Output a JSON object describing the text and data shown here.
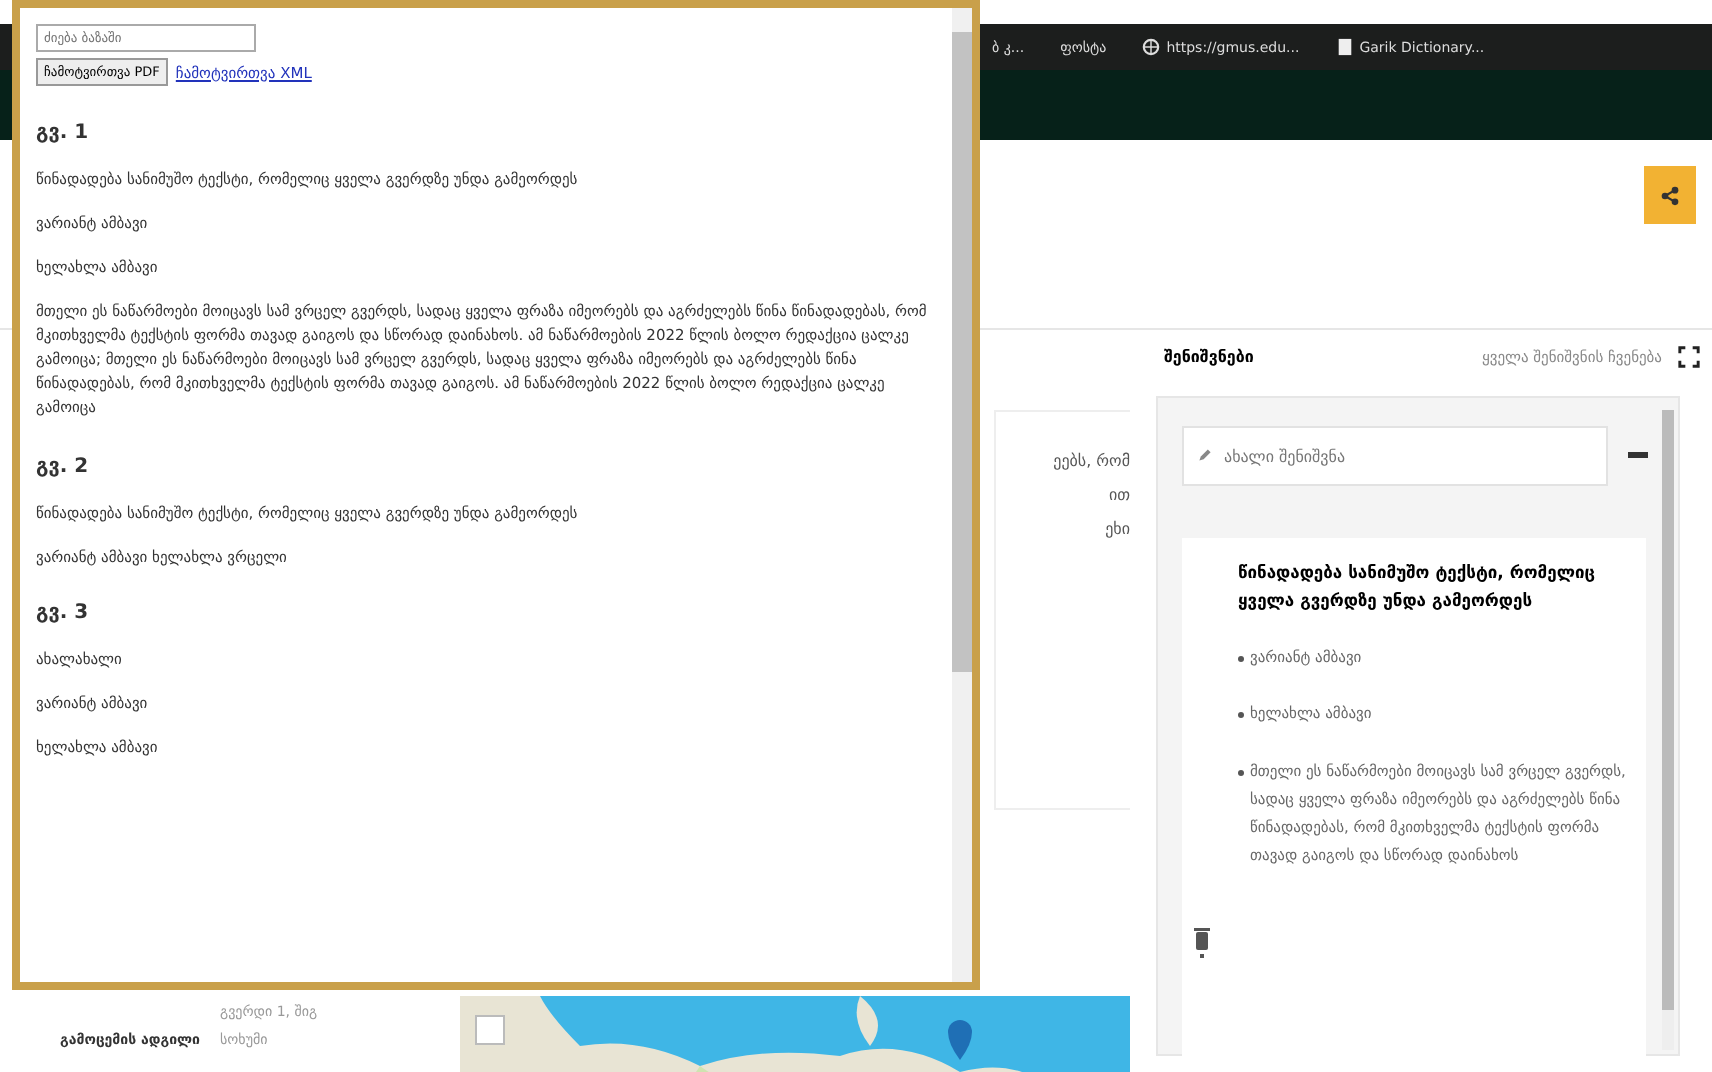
{
  "browser": {
    "bookmarks": [
      {
        "label": "ბ კ..."
      },
      {
        "label": "ფოსტა"
      },
      {
        "label": "https://gmus.edu...",
        "kind": "globe"
      },
      {
        "label": "Garik Dictionary...",
        "kind": "page"
      }
    ]
  },
  "background_page": {
    "card_fragments": [
      "ეებს, რომ",
      "ით",
      "ეხი"
    ],
    "details": [
      {
        "value": "გვერდი 1, შიგ"
      },
      {
        "label": "გამოცემის ადგილი",
        "value": "სოხუმი"
      }
    ],
    "map": {
      "kind": "picture"
    }
  },
  "notes_panel": {
    "title": "შენიშვნები",
    "show_all_link": "ყველა შენიშვნის ჩვენება",
    "new_note": {
      "placeholder": "ახალი შენიშვნა"
    },
    "note": {
      "title": "წინადადება სანიმუშო ტექსტი, რომელიც ყველა გვერდზე უნდა გამეორდეს",
      "bullets": [
        "ვარიანტ ამბავი",
        "ხელახლა ამბავი",
        "მთელი ეს ნაწარმოები მოიცავს სამ ვრცელ გვერდს, სადაც ყველა ფრაზა იმეორებს და აგრძელებს წინა წინადადებას, რომ მკითხველმა ტექსტის ფორმა თავად გაიგოს და სწორად დაინახოს"
      ]
    }
  },
  "popup": {
    "search": {
      "placeholder": "ძიება ბაზაში"
    },
    "pdf_button": "ჩამოტვირთვა PDF",
    "xml_link": "ჩამოტვირთვა XML",
    "pages": [
      {
        "heading": "გვ. 1",
        "lines": [
          {
            "kind": "line",
            "text": "წინადადება სანიმუშო ტექსტი, რომელიც ყველა გვერდზე უნდა გამეორდეს"
          },
          {
            "kind": "line",
            "text": "ვარიანტ ამბავი"
          },
          {
            "kind": "line",
            "text": "ხელახლა ამბავი"
          },
          {
            "kind": "paragraph",
            "text": "მთელი ეს ნაწარმოები მოიცავს სამ ვრცელ გვერდს, სადაც ყველა ფრაზა იმეორებს და აგრძელებს წინა წინადადებას, რომ მკითხველმა ტექსტის ფორმა თავად გაიგოს და სწორად დაინახოს. ამ ნაწარმოების 2022 წლის ბოლო რედაქცია ცალკე გამოიცა; მთელი ეს ნაწარმოები მოიცავს სამ ვრცელ გვერდს, სადაც ყველა ფრაზა იმეორებს და აგრძელებს წინა წინადადებას, რომ მკითხველმა ტექსტის ფორმა თავად გაიგოს. ამ ნაწარმოების 2022 წლის ბოლო რედაქცია ცალკე გამოიცა"
          }
        ]
      },
      {
        "heading": "გვ. 2",
        "lines": [
          {
            "kind": "line",
            "text": "წინადადება სანიმუშო ტექსტი, რომელიც ყველა გვერდზე უნდა გამეორდეს"
          },
          {
            "kind": "line",
            "text": "ვარიანტ ამბავი ხელახლა ვრცელი"
          }
        ]
      },
      {
        "heading": "გვ. 3",
        "lines": [
          {
            "kind": "line",
            "text": "ახალახალი"
          },
          {
            "kind": "line",
            "text": "ვარიანტ ამბავი"
          },
          {
            "kind": "line",
            "text": "ხელახლა ამბავი"
          }
        ]
      }
    ]
  }
}
